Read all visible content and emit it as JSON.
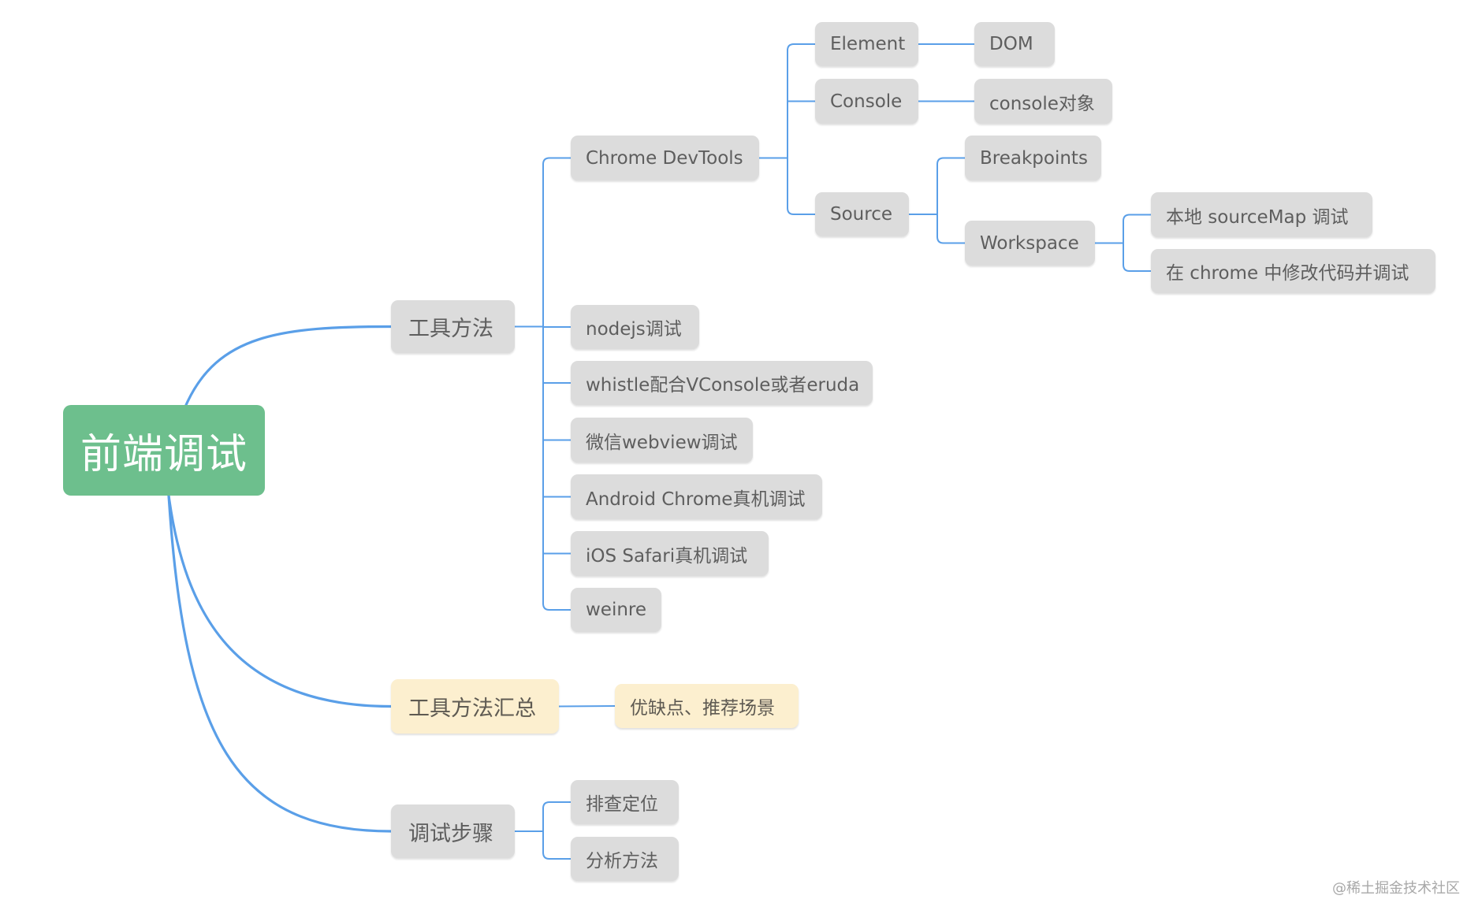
{
  "mindmap": {
    "root": {
      "id": "root",
      "label": "前端调试",
      "color": "#6dbf8d"
    },
    "colors": {
      "connector": "#5a9fe8",
      "node_bg": "#dcdcdc",
      "summary_bg": "#fcefcf",
      "text": "#5e5e5e"
    },
    "nodes": [
      {
        "id": "tools",
        "parent": "root",
        "label": "工具方法"
      },
      {
        "id": "devtools",
        "parent": "tools",
        "label": "Chrome DevTools"
      },
      {
        "id": "element",
        "parent": "devtools",
        "label": "Element"
      },
      {
        "id": "dom",
        "parent": "element",
        "label": "DOM"
      },
      {
        "id": "console",
        "parent": "devtools",
        "label": "Console"
      },
      {
        "id": "console-obj",
        "parent": "console",
        "label": "console对象"
      },
      {
        "id": "source",
        "parent": "devtools",
        "label": "Source"
      },
      {
        "id": "breakpoints",
        "parent": "source",
        "label": "Breakpoints"
      },
      {
        "id": "workspace",
        "parent": "source",
        "label": "Workspace"
      },
      {
        "id": "sourcemap",
        "parent": "workspace",
        "label": "本地 sourceMap 调试"
      },
      {
        "id": "chrome-edit",
        "parent": "workspace",
        "label": "在 chrome 中修改代码并调试"
      },
      {
        "id": "nodejs",
        "parent": "tools",
        "label": "nodejs调试"
      },
      {
        "id": "whistle",
        "parent": "tools",
        "label": "whistle配合VConsole或者eruda"
      },
      {
        "id": "wechat",
        "parent": "tools",
        "label": "微信webview调试"
      },
      {
        "id": "android",
        "parent": "tools",
        "label": "Android Chrome真机调试"
      },
      {
        "id": "ios",
        "parent": "tools",
        "label": "iOS Safari真机调试"
      },
      {
        "id": "weinre",
        "parent": "tools",
        "label": "weinre"
      },
      {
        "id": "summary",
        "parent": "root",
        "label": "工具方法汇总",
        "style": "yellow"
      },
      {
        "id": "pros-cons",
        "parent": "summary",
        "label": "优缺点、推荐场景",
        "style": "yellow"
      },
      {
        "id": "steps",
        "parent": "root",
        "label": "调试步骤"
      },
      {
        "id": "locate",
        "parent": "steps",
        "label": "排查定位"
      },
      {
        "id": "analyze",
        "parent": "steps",
        "label": "分析方法"
      }
    ]
  },
  "watermark": "@稀土掘金技术社区"
}
